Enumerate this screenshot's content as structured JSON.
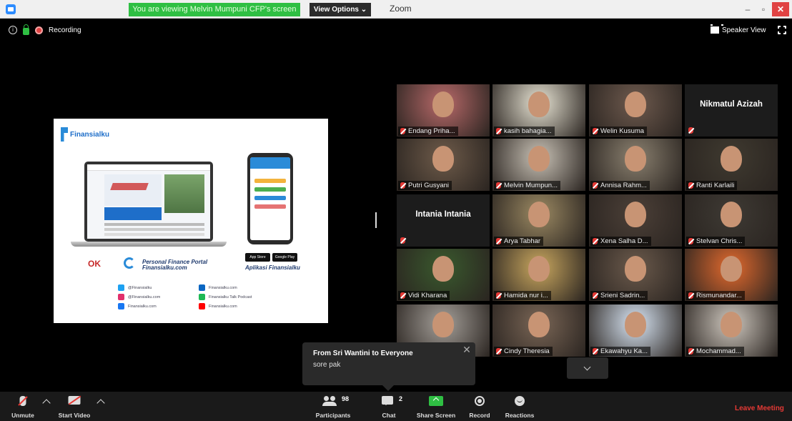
{
  "titlebar": {
    "viewing_banner": "You are viewing Melvin Mumpuni CFP's screen",
    "view_options_label": "View Options ⌄",
    "app_title": "Zoom",
    "minimize_label": "–",
    "maximize_label": "▫",
    "close_label": "✕"
  },
  "top_bar": {
    "info_glyph": "i",
    "recording_label": "Recording",
    "speaker_view_label": "Speaker View"
  },
  "slide": {
    "logo_text": "Finansialku",
    "ojk_label": "OK",
    "portal_line1": "Personal Finance Portal",
    "portal_line2": "Finansialku.com",
    "app_label": "Aplikasi Finansialku",
    "store1_label": "App Store",
    "store2_label": "Google Play",
    "socials": [
      {
        "text": "@Finansialku",
        "color": "#1da1f2",
        "icon": "twitter-icon"
      },
      {
        "text": "@Finansialku.com",
        "color": "#e1306c",
        "icon": "instagram-icon"
      },
      {
        "text": "Finansialku.com",
        "color": "#1877f2",
        "icon": "facebook-icon"
      },
      {
        "text": "Finansialku.com",
        "color": "#0a66c2",
        "icon": "linkedin-icon"
      },
      {
        "text": "Finansialku Talk Podcast",
        "color": "#1db954",
        "icon": "spotify-icon"
      },
      {
        "text": "Finansialku.com",
        "color": "#ff0000",
        "icon": "youtube-icon"
      }
    ]
  },
  "participants": [
    {
      "name": "Endang Priha...",
      "video": true,
      "bg": "#b96a6a",
      "active": false
    },
    {
      "name": "kasih bahagia...",
      "video": true,
      "bg": "#e8e4d4",
      "active": false
    },
    {
      "name": "Welin Kusuma",
      "video": true,
      "bg": "#6e5a4e",
      "active": false
    },
    {
      "name": "Nikmatul Azizah",
      "video": false,
      "bg": "#1c1c1c",
      "active": false
    },
    {
      "name": "Putri Gusyani",
      "video": true,
      "bg": "#6e5b4a",
      "active": false
    },
    {
      "name": "Melvin Mumpun...",
      "video": true,
      "bg": "#c9c2b6",
      "active": true
    },
    {
      "name": "Annisa Rahm...",
      "video": true,
      "bg": "#8b8170",
      "active": false
    },
    {
      "name": "Ranti Karlaili",
      "video": true,
      "bg": "#3f3a30",
      "active": false
    },
    {
      "name": "Intania Intania",
      "video": false,
      "bg": "#1c1c1c",
      "active": false
    },
    {
      "name": "Arya Tabhar",
      "video": true,
      "bg": "#9c8a63",
      "active": false
    },
    {
      "name": "Xena Salha D...",
      "video": true,
      "bg": "#4c4038",
      "active": false
    },
    {
      "name": "Stelvan Chris...",
      "video": true,
      "bg": "#3e3a34",
      "active": false
    },
    {
      "name": "Vidi Kharana",
      "video": true,
      "bg": "#3a5a2e",
      "active": false
    },
    {
      "name": "Hamida nur i...",
      "video": true,
      "bg": "#c9a75f",
      "active": false
    },
    {
      "name": "Srieni Sadrin...",
      "video": true,
      "bg": "#6b5a4c",
      "active": false
    },
    {
      "name": "Rismunandar...",
      "video": true,
      "bg": "#e36a2e",
      "active": false
    },
    {
      "name": "",
      "video": true,
      "bg": "#a5a09a",
      "active": false
    },
    {
      "name": "Cindy Theresia",
      "video": true,
      "bg": "#7a6656",
      "active": false
    },
    {
      "name": "Ekawahyu Ka...",
      "video": true,
      "bg": "#d9e6f5",
      "active": false
    },
    {
      "name": "Mochammad...",
      "video": true,
      "bg": "#cfc8bf",
      "active": false
    }
  ],
  "chat": {
    "from": "From Sri Wantini to Everyone",
    "message": "sore pak",
    "close_label": "✕"
  },
  "toolbar": {
    "unmute_label": "Unmute",
    "start_video_label": "Start Video",
    "participants_label": "Participants",
    "participants_count": "98",
    "chat_label": "Chat",
    "chat_count": "2",
    "share_screen_label": "Share Screen",
    "record_label": "Record",
    "reactions_label": "Reactions",
    "leave_label": "Leave Meeting"
  }
}
